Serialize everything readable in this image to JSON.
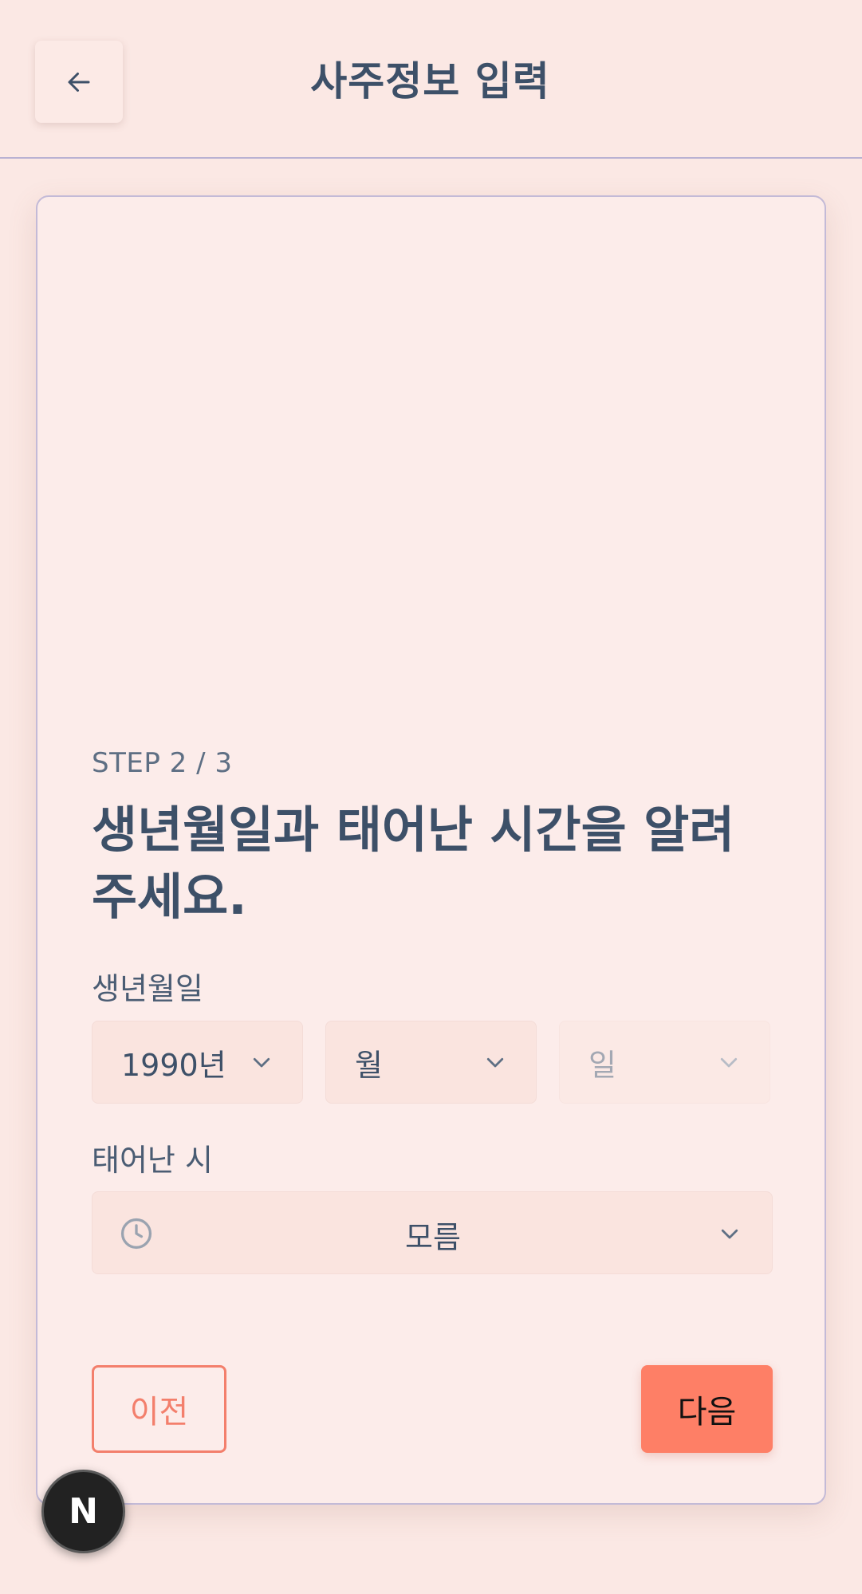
{
  "header": {
    "title": "사주정보 입력",
    "back_icon": "arrow-left-icon"
  },
  "form": {
    "step": "STEP 2 / 3",
    "heading": "생년월일과 태어난 시간을 알려주세요.",
    "dob_label": "생년월일",
    "year_value": "1990년",
    "month_placeholder": "월",
    "day_placeholder": "일",
    "time_label": "태어난 시",
    "time_value": "모름",
    "clock_icon": "clock-icon",
    "chevron_icon": "chevron-down-icon"
  },
  "actions": {
    "prev_label": "이전",
    "next_label": "다음"
  },
  "badge": {
    "label": "N"
  },
  "colors": {
    "background": "#fbe8e4",
    "card": "#fcecea",
    "accent": "#fe7f66",
    "text": "#3d5068"
  }
}
